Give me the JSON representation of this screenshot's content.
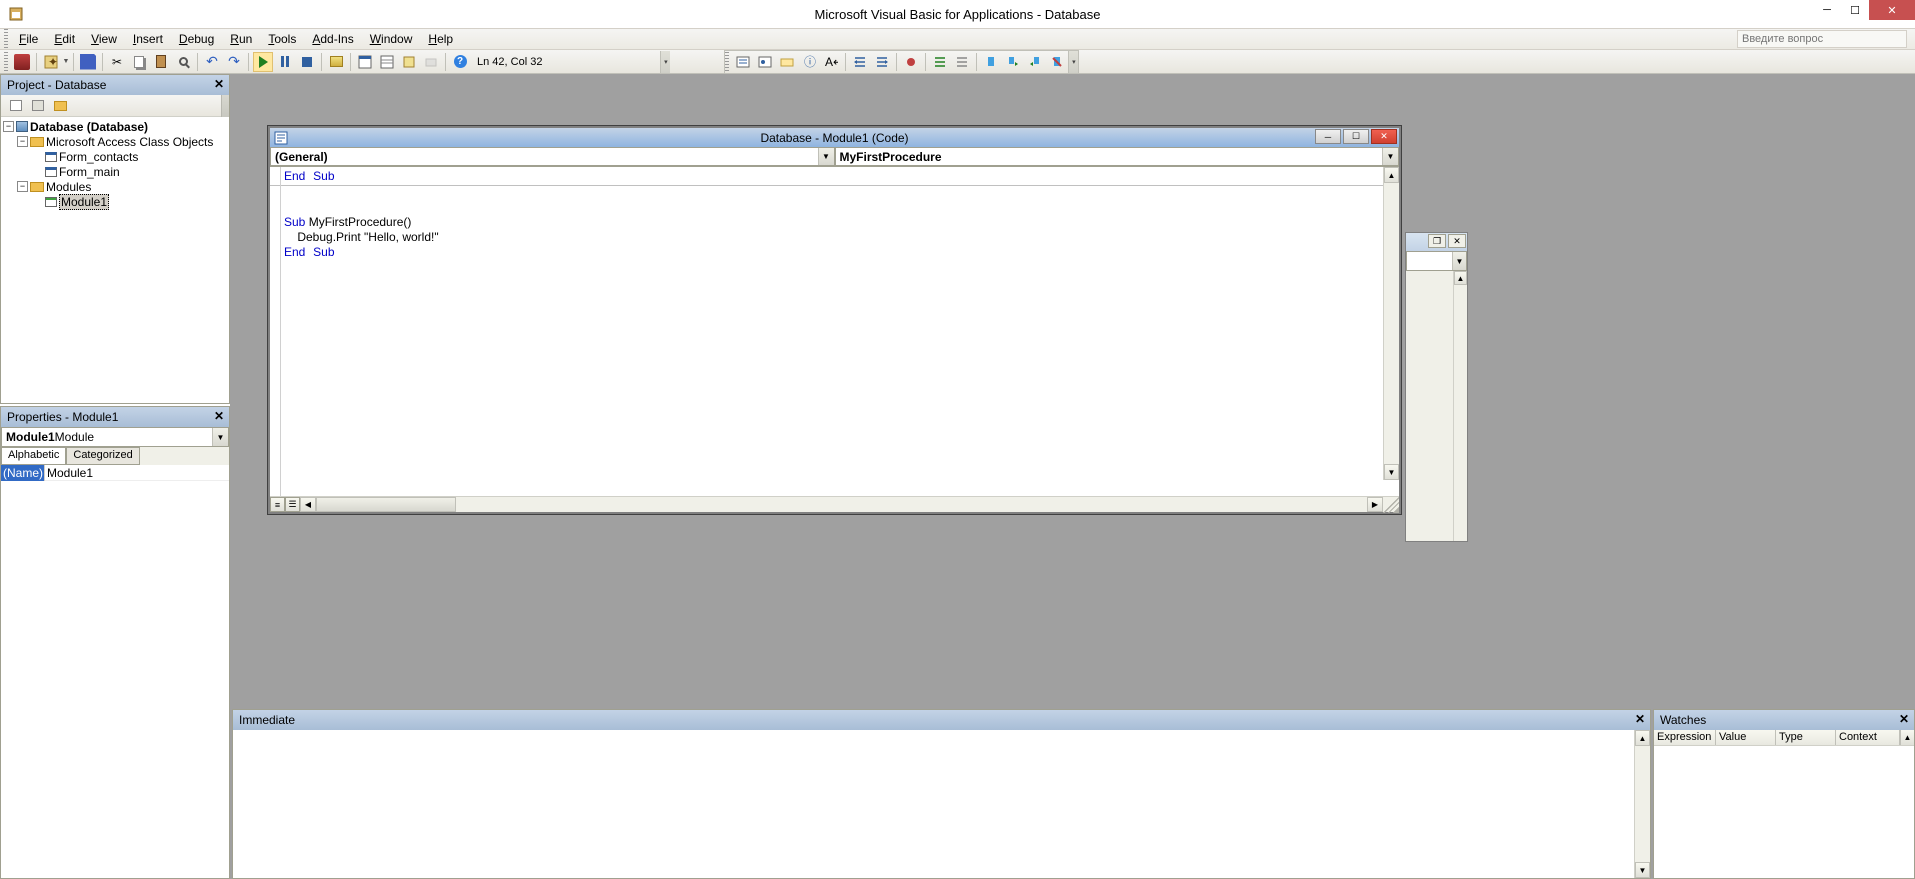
{
  "title": "Microsoft Visual Basic for Applications - Database",
  "menu": {
    "file": "File",
    "edit": "Edit",
    "view": "View",
    "insert": "Insert",
    "debug": "Debug",
    "run": "Run",
    "tools": "Tools",
    "addins": "Add-Ins",
    "window": "Window",
    "help": "Help",
    "search_placeholder": "Введите вопрос"
  },
  "toolbar": {
    "status": "Ln 42, Col 32"
  },
  "project_panel": {
    "title": "Project - Database",
    "root": "Database (Database)",
    "group_class": "Microsoft Access Class Objects",
    "form_contacts": "Form_contacts",
    "form_main": "Form_main",
    "group_modules": "Modules",
    "module1": "Module1"
  },
  "properties_panel": {
    "title": "Properties - Module1",
    "combo_bold": "Module1",
    "combo_rest": " Module",
    "tab_alpha": "Alphabetic",
    "tab_cat": "Categorized",
    "prop_name_label": "(Name)",
    "prop_name_value": "Module1"
  },
  "code_window": {
    "title": "Database - Module1 (Code)",
    "combo_left": "(General)",
    "combo_right": "MyFirstProcedure",
    "line1_kw1": "End",
    "line1_kw2": "Sub",
    "line3_kw": "Sub",
    "line3_rest": " MyFirstProcedure()",
    "line4": "    Debug.Print \"Hello, world!\"",
    "line5_kw1": "End",
    "line5_kw2": "Sub"
  },
  "immediate": {
    "title": "Immediate"
  },
  "watches": {
    "title": "Watches",
    "col_expr": "Expression",
    "col_value": "Value",
    "col_type": "Type",
    "col_context": "Context"
  }
}
